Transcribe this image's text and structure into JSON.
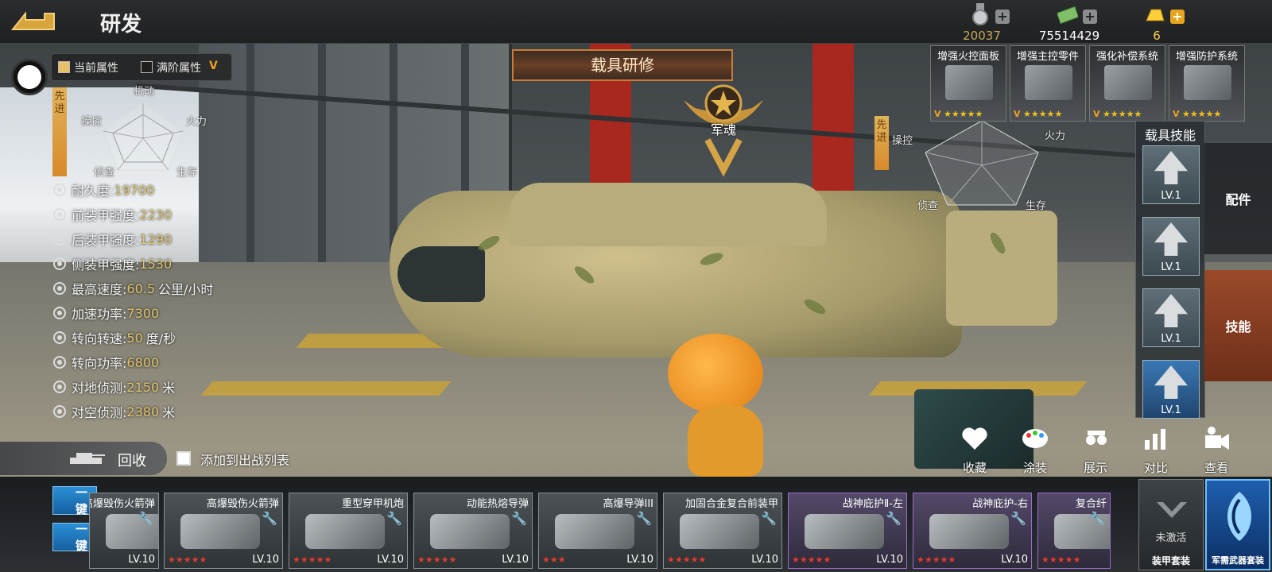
{
  "header": {
    "title": "研发",
    "resources": [
      {
        "icon": "medal-icon",
        "value": "20037",
        "color": "#c9a75a"
      },
      {
        "icon": "cash-icon",
        "value": "75514429",
        "color": "#ffffff"
      },
      {
        "icon": "gold-bar-icon",
        "value": "6",
        "color": "#ffd24a"
      }
    ]
  },
  "legend": {
    "current": "当前属性",
    "max": "满阶属性",
    "max_mark": "V"
  },
  "radar": {
    "tag": "先进",
    "labels": [
      "机动",
      "火力",
      "生存",
      "侦查",
      "操控"
    ]
  },
  "stats": [
    {
      "icon": "durability-icon",
      "label": "耐久度: ",
      "value": "19700",
      "unit": ""
    },
    {
      "icon": "front-armor-icon",
      "label": "前装甲强度: ",
      "value": "2230",
      "unit": ""
    },
    {
      "icon": "rear-armor-icon",
      "label": "后装甲强度: ",
      "value": "1290",
      "unit": ""
    },
    {
      "icon": "side-armor-icon",
      "label": "侧装甲强度: ",
      "value": "1530",
      "unit": ""
    },
    {
      "icon": "speed-icon",
      "label": "最高速度: ",
      "value": "60.5",
      "unit": "公里/小时"
    },
    {
      "icon": "acceleration-icon",
      "label": "加速功率: ",
      "value": "7300",
      "unit": ""
    },
    {
      "icon": "turn-speed-icon",
      "label": "转向转速: ",
      "value": "50",
      "unit": "度/秒"
    },
    {
      "icon": "turn-power-icon",
      "label": "转向功率: ",
      "value": "6800",
      "unit": ""
    },
    {
      "icon": "ground-detect-icon",
      "label": "对地侦测: ",
      "value": "2150",
      "unit": "米"
    },
    {
      "icon": "air-detect-icon",
      "label": "对空侦测: ",
      "value": "2380",
      "unit": "米"
    }
  ],
  "research_tab": "载具研修",
  "soul": "军魂",
  "radar2": {
    "tag": "先进",
    "labels": [
      "操控",
      "火力",
      "侦查",
      "生存"
    ]
  },
  "enhancements": [
    {
      "label": "增强火控面板",
      "mark": "V",
      "stars": "★★★★★"
    },
    {
      "label": "增强主控零件",
      "mark": "V",
      "stars": "★★★★★"
    },
    {
      "label": "强化补偿系统",
      "mark": "V",
      "stars": "★★★★★"
    },
    {
      "label": "增强防护系统",
      "mark": "V",
      "stars": "★★★★★"
    }
  ],
  "skills": {
    "title": "载具技能",
    "slots": [
      {
        "lv": "LV.1"
      },
      {
        "lv": "LV.1"
      },
      {
        "lv": "LV.1"
      },
      {
        "lv": "LV.1"
      }
    ]
  },
  "side_tabs": {
    "parts": "配件",
    "skills": "技能"
  },
  "actions": [
    {
      "icon": "heart-icon",
      "label": "收藏"
    },
    {
      "icon": "paint-palette-icon",
      "label": "涂装"
    },
    {
      "icon": "showcase-icon",
      "label": "展示"
    },
    {
      "icon": "compare-icon",
      "label": "对比"
    },
    {
      "icon": "camera-icon",
      "label": "查看"
    }
  ],
  "recycle": "回收",
  "add_to_battle": "添加到出战列表",
  "onekey": [
    "一键",
    "一键"
  ],
  "cards": [
    {
      "name": "高爆毁伤火箭弹",
      "lv": "LV.10",
      "stars": "",
      "purple": false
    },
    {
      "name": "高爆毁伤火箭弹",
      "lv": "LV.10",
      "stars": "★★★★★",
      "purple": false
    },
    {
      "name": "重型穿甲机炮",
      "lv": "LV.10",
      "stars": "★★★★★",
      "purple": false
    },
    {
      "name": "动能热熔导弹",
      "lv": "LV.10",
      "stars": "★★★★★",
      "purple": false
    },
    {
      "name": "高爆导弹III",
      "lv": "LV.10",
      "stars": "★★★",
      "purple": false
    },
    {
      "name": "加固合金复合前装甲",
      "lv": "LV.10",
      "stars": "★★★★★",
      "purple": false
    },
    {
      "name": "战神庇护Ⅱ-左",
      "lv": "LV.10",
      "stars": "★★★★★",
      "purple": true
    },
    {
      "name": "战神庇护-右",
      "lv": "LV.10",
      "stars": "★★★★★",
      "purple": true
    },
    {
      "name": "复合纤",
      "lv": "",
      "stars": "★★★★★",
      "purple": true
    }
  ],
  "suits": [
    {
      "label": "未激活",
      "sub": "装甲套装"
    },
    {
      "label": "军需武器套装"
    }
  ]
}
